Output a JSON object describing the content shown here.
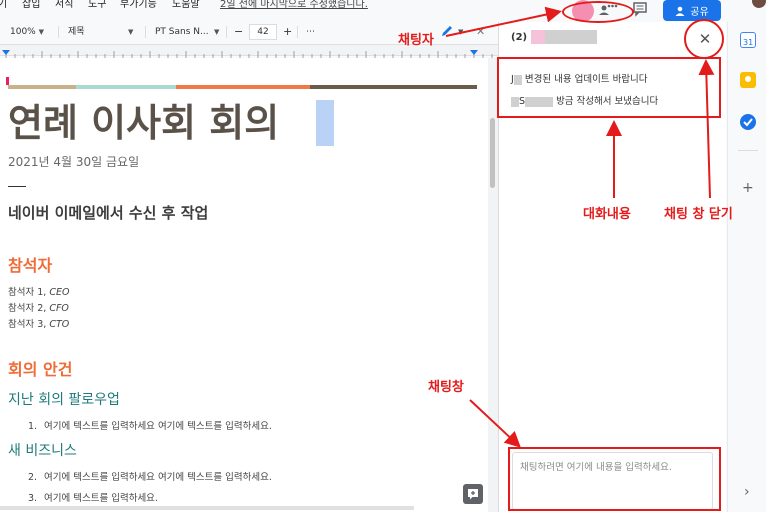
{
  "menu": {
    "items": [
      "기",
      "삽입",
      "서식",
      "도구",
      "부가기능",
      "도움말"
    ],
    "last_edit": "2일 전에 마지막으로 수정했습니다."
  },
  "header": {
    "share_label": "공유"
  },
  "toolbar": {
    "zoom": "100%",
    "style": "제목",
    "font": "PT Sans N...",
    "font_size": "42",
    "minus": "−",
    "plus": "+",
    "more": "⋯"
  },
  "document": {
    "title": "연례 이사회 회의",
    "date": "2021년 4월 30일 금요일",
    "note_heading": "네이버 이메일에서 수신 후 작업",
    "attendees_heading": "참석자",
    "attendees": [
      {
        "name": "참석자 1, ",
        "role": "CEO"
      },
      {
        "name": "참석자 2, ",
        "role": "CFO"
      },
      {
        "name": "참석자 3, ",
        "role": "CTO"
      }
    ],
    "agenda_heading": "회의 안건",
    "followup_heading": "지난 회의 팔로우업",
    "followup_items": [
      {
        "num": "1.",
        "text": "여기에 텍스트를 입력하세요 여기에 텍스트를 입력하세요."
      }
    ],
    "new_business_heading": "새 비즈니스",
    "new_business_items": [
      {
        "num": "2.",
        "text": "여기에 텍스트를 입력하세요 여기에 텍스트를 입력하세요."
      },
      {
        "num": "3.",
        "text": "여기에 텍스트를 입력하세요."
      }
    ],
    "band_colors": [
      "#c9b28a",
      "#a8dcd1",
      "#ef7a45",
      "#6b5d4b"
    ]
  },
  "chat": {
    "count": "(2)",
    "close": "✕",
    "messages": [
      {
        "prefix": "J",
        "text": "변경된 내용 업데이트 바랍니다"
      },
      {
        "prefix": "S",
        "text": "방금 작성해서 보냈습니다"
      }
    ],
    "input_placeholder": "채팅하려면 여기에 내용을 입력하세요."
  },
  "annotations": {
    "chatter": "채팅자",
    "conversation": "대화내용",
    "close_chat": "채팅 창 닫기",
    "chat_window": "채팅창",
    "color": "#e41b1b"
  },
  "sidebar": {
    "expand": "›",
    "add": "+"
  }
}
